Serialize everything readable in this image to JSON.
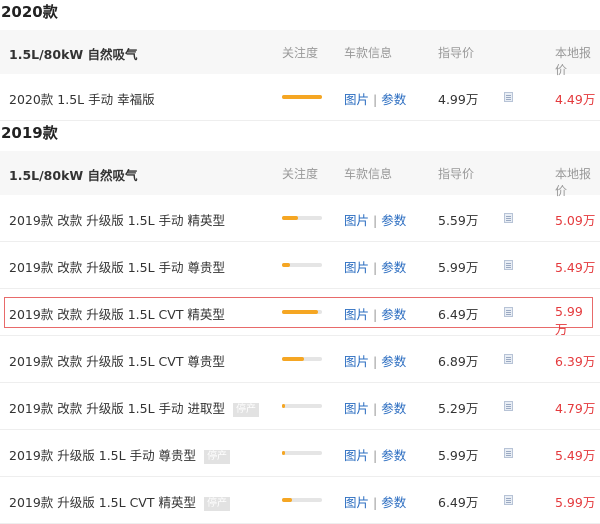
{
  "sections": [
    {
      "year": "2020款",
      "engine": "1.5L/80kW 自然吸气",
      "headers": {
        "attention": "关注度",
        "info": "车款信息",
        "guide": "指导价",
        "local": "本地报价"
      },
      "rows": [
        {
          "name": "2020款 1.5L 手动 幸福版",
          "attention": 1.0,
          "pic": "图片",
          "sep": "|",
          "param": "参数",
          "guide": "4.99万",
          "local": "4.49万",
          "stopped": ""
        }
      ]
    },
    {
      "year": "2019款",
      "engine": "1.5L/80kW 自然吸气",
      "headers": {
        "attention": "关注度",
        "info": "车款信息",
        "guide": "指导价",
        "local": "本地报价"
      },
      "rows": [
        {
          "name": "2019款 改款 升级版 1.5L 手动 精英型",
          "attention": 0.4,
          "pic": "图片",
          "sep": "|",
          "param": "参数",
          "guide": "5.59万",
          "local": "5.09万",
          "stopped": ""
        },
        {
          "name": "2019款 改款 升级版 1.5L 手动 尊贵型",
          "attention": 0.2,
          "pic": "图片",
          "sep": "|",
          "param": "参数",
          "guide": "5.99万",
          "local": "5.49万",
          "stopped": ""
        },
        {
          "name": "2019款 改款 升级版 1.5L CVT 精英型",
          "attention": 0.9,
          "pic": "图片",
          "sep": "|",
          "param": "参数",
          "guide": "6.49万",
          "local": "5.99万",
          "stopped": "",
          "highlighted": true
        },
        {
          "name": "2019款 改款 升级版 1.5L CVT 尊贵型",
          "attention": 0.55,
          "pic": "图片",
          "sep": "|",
          "param": "参数",
          "guide": "6.89万",
          "local": "6.39万",
          "stopped": ""
        },
        {
          "name": "2019款 改款 升级版 1.5L 手动 进取型",
          "attention": 0.08,
          "pic": "图片",
          "sep": "|",
          "param": "参数",
          "guide": "5.29万",
          "local": "4.79万",
          "stopped": "停产"
        },
        {
          "name": "2019款 升级版 1.5L 手动 尊贵型",
          "attention": 0.08,
          "pic": "图片",
          "sep": "|",
          "param": "参数",
          "guide": "5.99万",
          "local": "5.49万",
          "stopped": "停产"
        },
        {
          "name": "2019款 升级版 1.5L CVT 精英型",
          "attention": 0.25,
          "pic": "图片",
          "sep": "|",
          "param": "参数",
          "guide": "6.49万",
          "local": "5.99万",
          "stopped": "停产"
        }
      ]
    }
  ],
  "colors": {
    "accent_price": "#e4393c",
    "link": "#2a6cc0",
    "bar_fill": "#f5a623",
    "highlight_border": "#e86a6a"
  },
  "icons": {
    "calc": "calculator-icon"
  }
}
